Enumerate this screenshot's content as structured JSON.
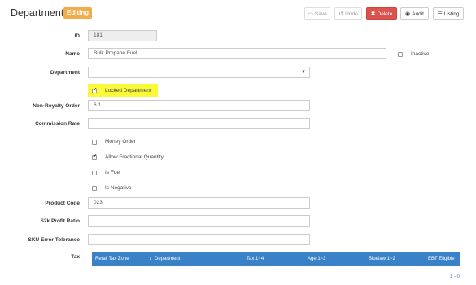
{
  "header": {
    "title": "Department",
    "badge": "Editing",
    "buttons": {
      "save": "Save",
      "undo": "Undo",
      "delete": "Delete",
      "audit": "Audit",
      "listing": "Listing"
    }
  },
  "form": {
    "id": {
      "label": "ID",
      "value": "181"
    },
    "name": {
      "label": "Name",
      "value": "Bulk Propane Fuel"
    },
    "inactive": {
      "label": "Inactive",
      "checked": false
    },
    "department": {
      "label": "Department",
      "value": ""
    },
    "locked_department": {
      "label": "Locked Department",
      "checked": true
    },
    "non_royalty_order": {
      "label": "Non-Royalty Order",
      "value": "6.1"
    },
    "commission_rate": {
      "label": "Commission Rate",
      "value": ""
    },
    "money_order": {
      "label": "Money Order",
      "checked": false
    },
    "allow_fractional": {
      "label": "Allow Fractional Quantity",
      "checked": true
    },
    "is_fuel": {
      "label": "Is Fuel",
      "checked": false
    },
    "is_negative": {
      "label": "Is Negative",
      "checked": false
    },
    "product_code": {
      "label": "Product Code",
      "value": "023"
    },
    "s2k_profit_ratio": {
      "label": "S2k Profit Ratio",
      "value": ""
    },
    "sku_error_tolerance": {
      "label": "SKU Error Tolerance",
      "value": ""
    },
    "tax": {
      "label": "Tax"
    }
  },
  "tax_table": {
    "columns": [
      "Retail Tax Zone",
      "Department",
      "Tax 1~4",
      "Age 1~3",
      "Bluelaw 1~2",
      "EBT Eligible"
    ],
    "pager": "1 - 0"
  },
  "colors": {
    "accent": "#3a82c8",
    "badge": "#f0ad4e",
    "danger": "#d9534f",
    "highlight": "#fafa3a"
  }
}
